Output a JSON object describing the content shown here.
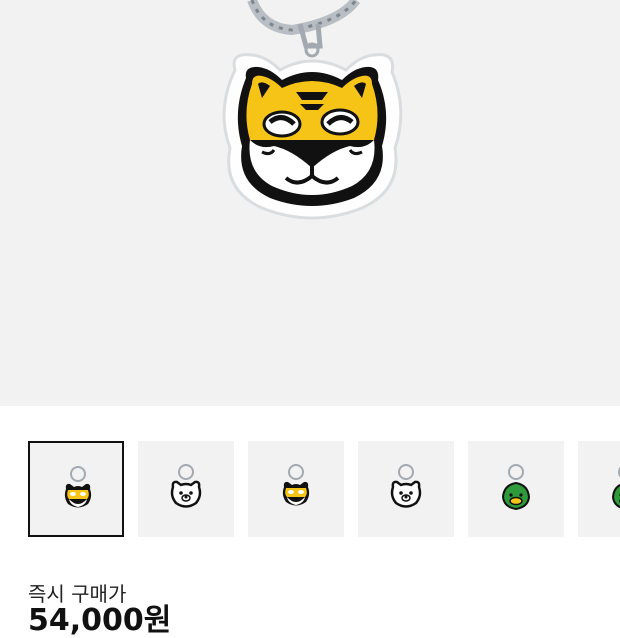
{
  "product": {
    "main_image": "tiger-keyring",
    "thumbnails": [
      {
        "icon": "tiger-keyring",
        "selected": true
      },
      {
        "icon": "bear-keyring",
        "selected": false
      },
      {
        "icon": "tiger-keyring",
        "selected": false
      },
      {
        "icon": "bear-keyring",
        "selected": false
      },
      {
        "icon": "duck-keyring",
        "selected": false
      },
      {
        "icon": "duck-keyring",
        "selected": false
      }
    ]
  },
  "purchase": {
    "label": "즉시 구매가",
    "price": "54,000원"
  },
  "colors": {
    "image_background": "#f2f2f2",
    "tiger_yellow": "#f6c417",
    "duck_green": "#2f9a3b",
    "selected_border": "#111111"
  }
}
